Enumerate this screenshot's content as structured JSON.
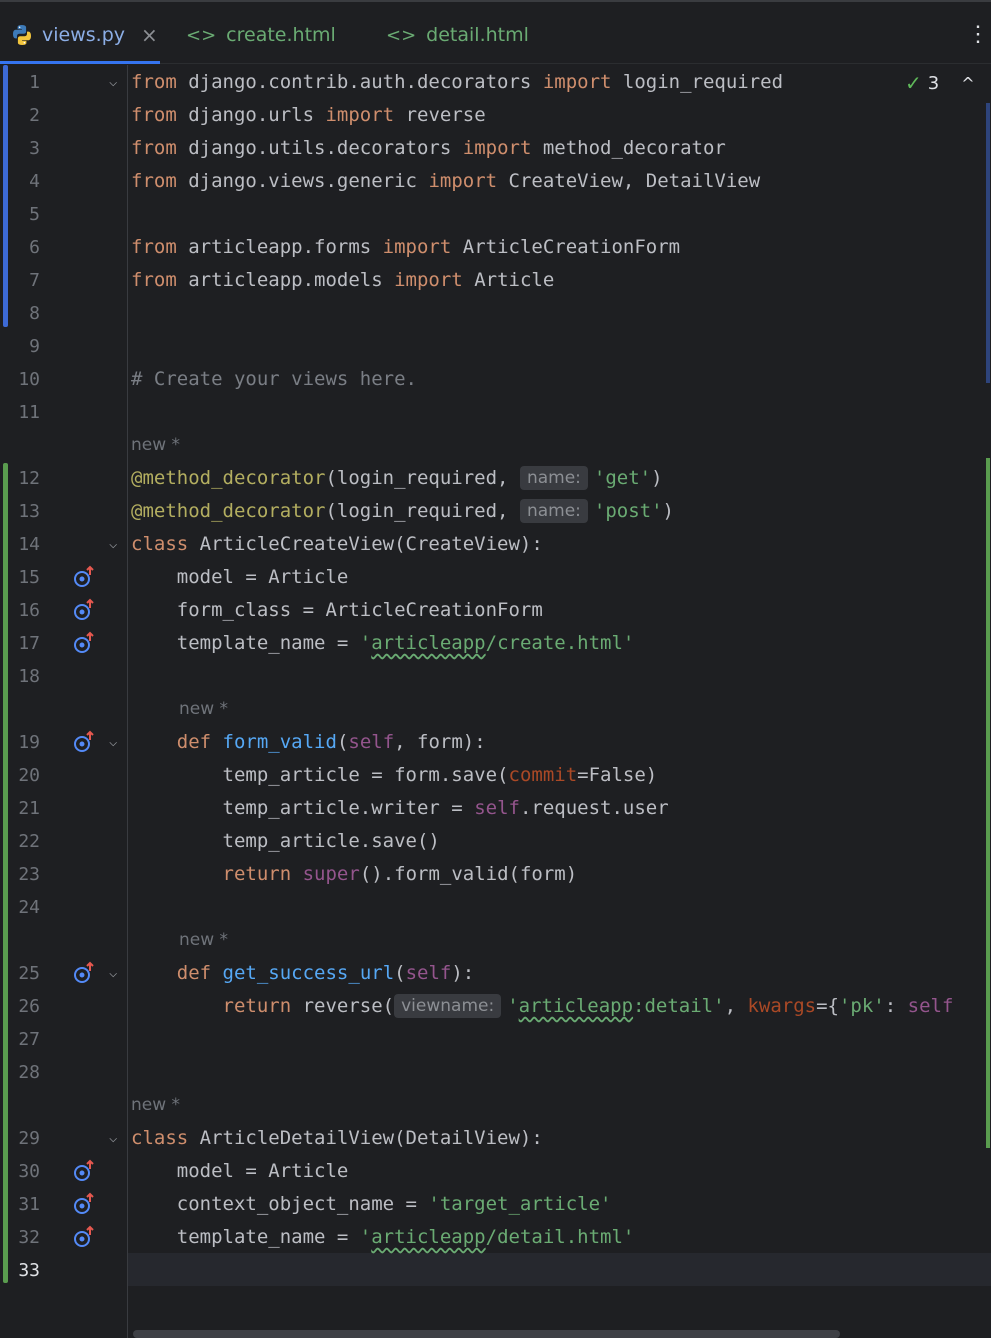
{
  "tabs": [
    {
      "label": "views.py",
      "active": true,
      "close": "×"
    },
    {
      "label": "create.html",
      "icon": "<>"
    },
    {
      "label": "detail.html",
      "icon": "<>"
    }
  ],
  "menu_dots": "⋮",
  "inspection": {
    "count": "3"
  },
  "new_hint": "new *",
  "hints": {
    "name": "name:",
    "viewname": "viewname:"
  },
  "line_numbers": [
    "1",
    "2",
    "3",
    "4",
    "5",
    "6",
    "7",
    "8",
    "9",
    "10",
    "11",
    "12",
    "13",
    "14",
    "15",
    "16",
    "17",
    "18",
    "19",
    "20",
    "21",
    "22",
    "23",
    "24",
    "25",
    "26",
    "27",
    "28",
    "29",
    "30",
    "31",
    "32",
    "33"
  ],
  "code": {
    "from": "from",
    "import": "import",
    "class": "class",
    "def": "def",
    "return": "return",
    "l1_mod": " django.contrib.auth.decorators ",
    "l1_name": " login_required",
    "l2_mod": " django.urls ",
    "l2_name": " reverse",
    "l3_mod": " django.utils.decorators ",
    "l3_name": " method_decorator",
    "l4_mod": " django.views.generic ",
    "l4_name": " CreateView, DetailView",
    "l6_mod": " articleapp.forms ",
    "l6_name": " ArticleCreationForm",
    "l7_mod": " articleapp.models ",
    "l7_name": " Article",
    "l10_comment": "# Create your views here.",
    "deco": "@method_decorator",
    "deco_args": "(login_required, ",
    "str_get": "'get'",
    "str_post": "'post'",
    "close_paren": ")",
    "l14_rest": " ArticleCreateView(CreateView):",
    "l15": "    model = Article",
    "l16": "    form_class = ArticleCreationForm",
    "l17_pre": "    template_name = ",
    "str_q": "'",
    "typo_articleapp": "articleapp",
    "l17_tail": "/create.html'",
    "indent4": "    ",
    "indent8": "        ",
    "fn_form_valid": "form_valid",
    "self": "self",
    "paren_open": "(",
    "l19_tail": ", form):",
    "l20_pre": "temp_article = form.save(",
    "commit": "commit",
    "l20_tail": "=False)",
    "l21_pre": "temp_article.writer = ",
    "l21_tail": ".request.user",
    "l22": "temp_article.save()",
    "super": "super",
    "l23_tail": "().form_valid(form)",
    "fn_success": "get_success_url",
    "l25_tail": "):",
    "l26_pre": " reverse(",
    "l26_str_tail": ":detail'",
    "comma_sp": ", ",
    "kwargs": "kwargs",
    "l26_mid": "={",
    "str_pk": "'pk'",
    "colon_sp": ": ",
    "l29_rest": " ArticleDetailView(DetailView):",
    "l30": "    model = Article",
    "l31_pre": "    context_object_name = ",
    "str_target": "'target_article'",
    "l32_tail": "/detail.html'"
  }
}
